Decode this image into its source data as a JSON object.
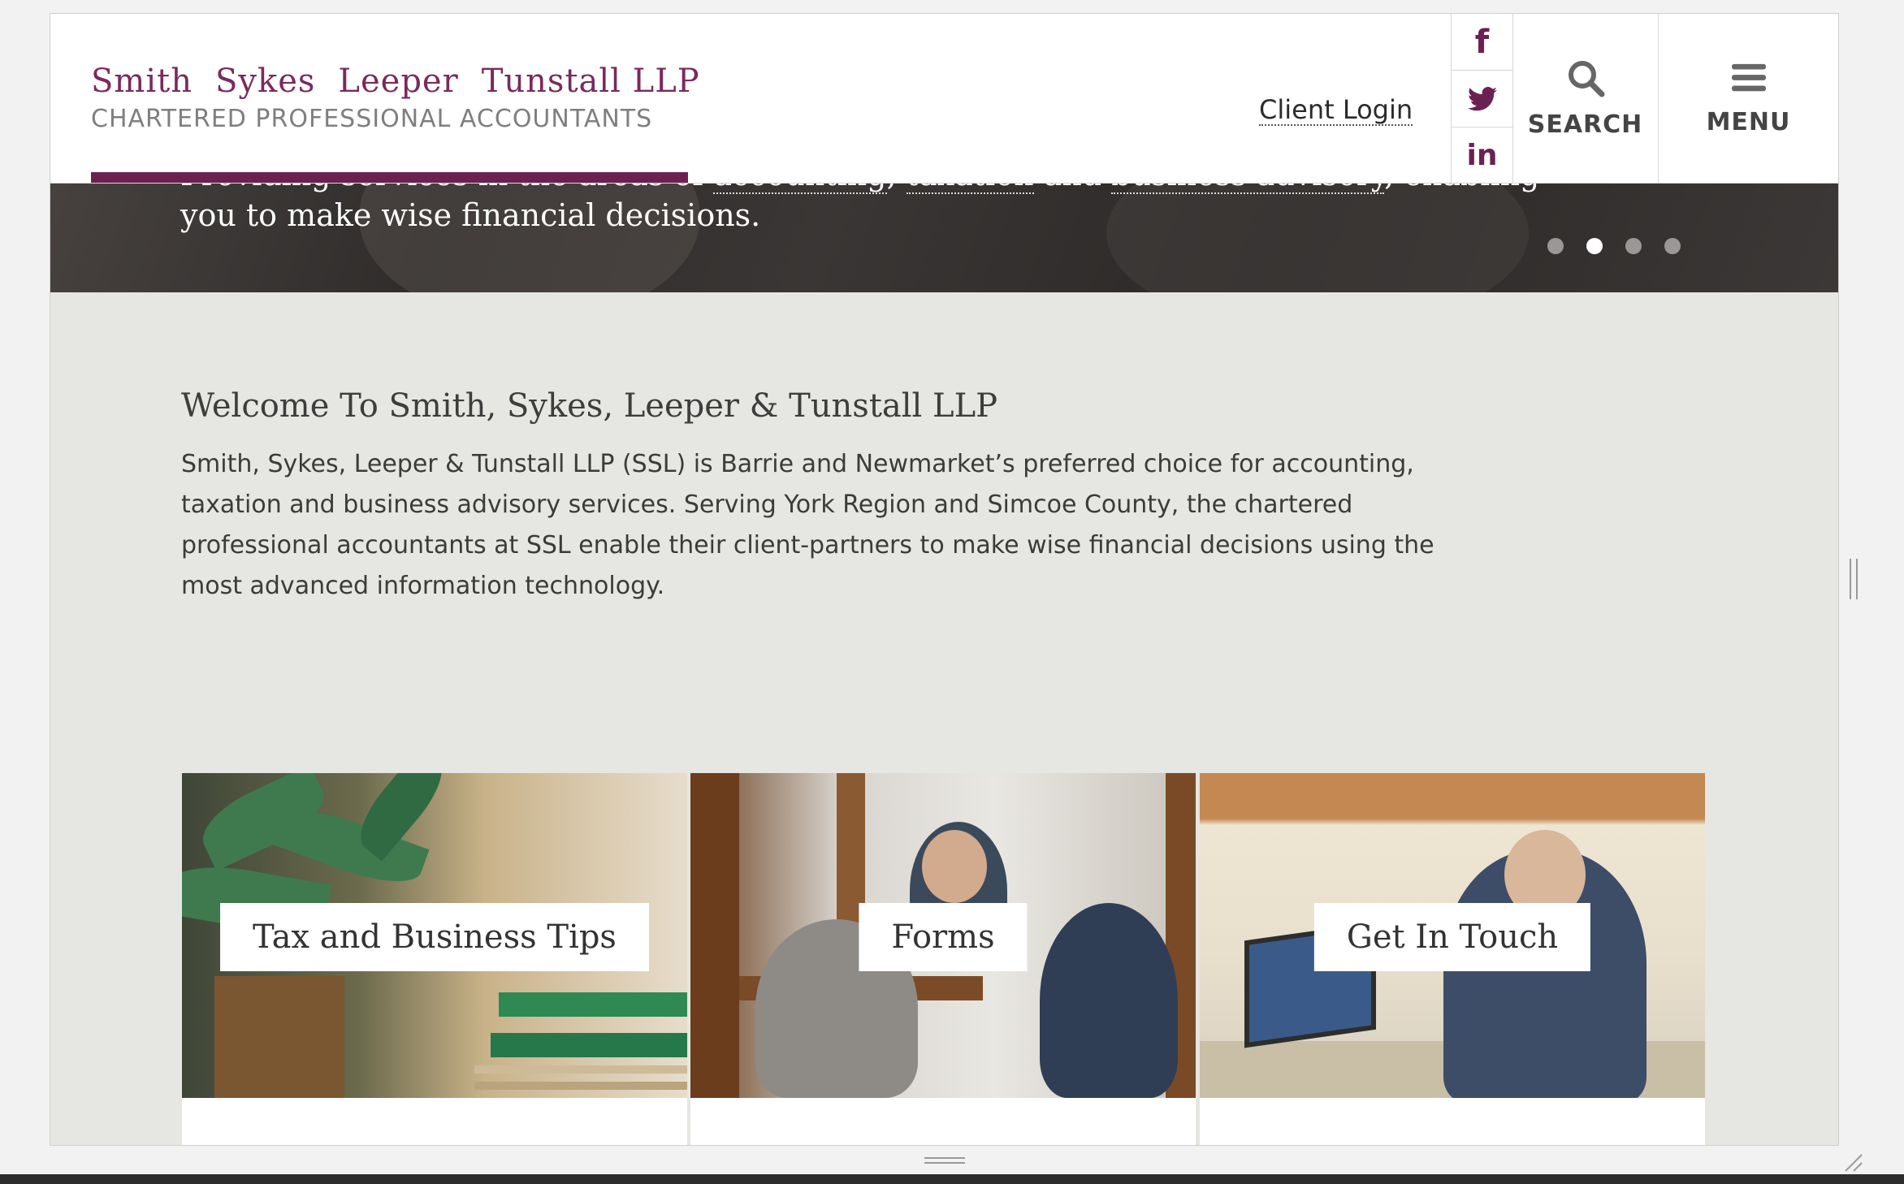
{
  "header": {
    "logo_line1_parts": [
      "Smith",
      "Sykes",
      "Leeper",
      "Tunstall LLP"
    ],
    "logo_line2": "CHARTERED PROFESSIONAL ACCOUNTANTS",
    "client_login": "Client Login",
    "search_label": "SEARCH",
    "menu_label": "MENU"
  },
  "social": {
    "facebook": "f",
    "twitter": "twitter-icon",
    "linkedin": "in"
  },
  "hero": {
    "line1_prefix": "Providing services in the areas of ",
    "line1_link1": "accounting",
    "line1_sep1": ", ",
    "line1_link2": "taxation",
    "line1_mid": " and ",
    "line1_link3": "business advisory",
    "line1_suffix": ", enabling",
    "line2": "you to make wise financial decisions.",
    "slides_total": 4,
    "active_slide": 2
  },
  "welcome": {
    "title": "Welcome To Smith, Sykes, Leeper & Tunstall LLP",
    "body": "Smith, Sykes, Leeper & Tunstall LLP (SSL) is Barrie and Newmarket’s preferred choice for accounting, taxation and business advisory services. Serving York Region and Simcoe County, the chartered professional accountants at SSL enable their client-partners to make wise financial decisions using the most advanced information technology."
  },
  "cards": [
    {
      "label": "Tax and Business Tips"
    },
    {
      "label": "Forms"
    },
    {
      "label": "Get In Touch"
    }
  ],
  "colors": {
    "brand": "#6b2150",
    "text": "#3b3b3b",
    "background": "#e6e6e2"
  }
}
